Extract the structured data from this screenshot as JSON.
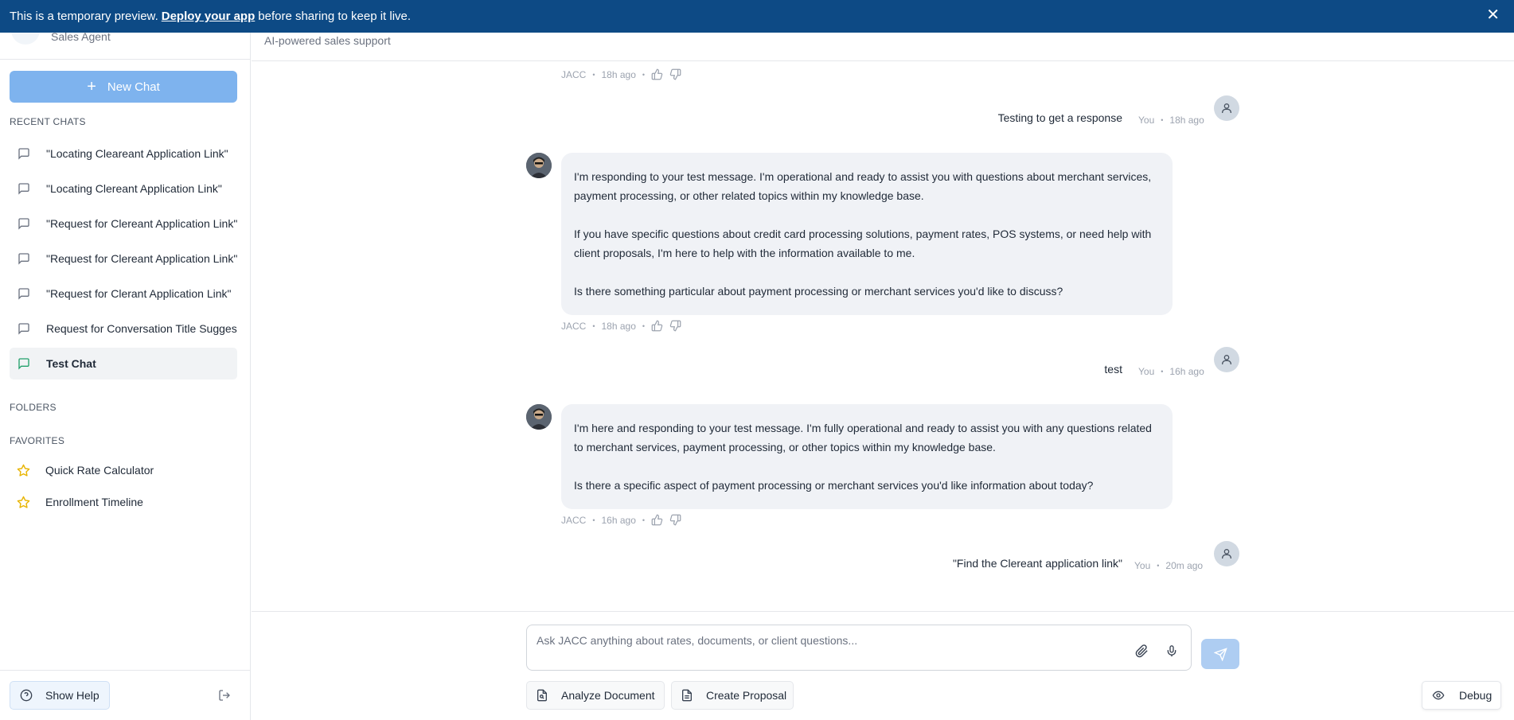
{
  "banner": {
    "prefix": "This is a temporary preview.",
    "link": "Deploy your app",
    "suffix": "before sharing to keep it live."
  },
  "sidebar": {
    "agent_role": "Sales Agent",
    "new_chat_label": "New Chat",
    "recent_title": "RECENT CHATS",
    "recent_chats": [
      "\"Locating Cleareant Application Link\"",
      "\"Locating Clereant Application Link\"",
      "\"Request for Clereant Application Link\"",
      "\"Request for Clereant Application Link\"",
      "\"Request for Clerant Application Link\"",
      "Request for Conversation Title Suggestion",
      "Test Chat"
    ],
    "folders_title": "FOLDERS",
    "favorites_title": "FAVORITES",
    "favorites": [
      "Quick Rate Calculator",
      "Enrollment Timeline"
    ],
    "show_help": "Show Help"
  },
  "header": {
    "subtitle": "AI-powered sales support"
  },
  "messages": {
    "m0": {
      "sender": "JACC",
      "time": "18h ago"
    },
    "m1": {
      "text": "Testing to get a response",
      "sender": "You",
      "time": "18h ago"
    },
    "m2": {
      "sender": "JACC",
      "time": "18h ago",
      "p1": "I'm responding to your test message. I'm operational and ready to assist you with questions about merchant services, payment processing, or other related topics within my knowledge base.",
      "p2": "If you have specific questions about credit card processing solutions, payment rates, POS systems, or need help with client proposals, I'm here to help with the information available to me.",
      "p3": "Is there something particular about payment processing or merchant services you'd like to discuss?"
    },
    "m3": {
      "text": "test",
      "sender": "You",
      "time": "16h ago"
    },
    "m4": {
      "sender": "JACC",
      "time": "16h ago",
      "p1": "I'm here and responding to your test message. I'm fully operational and ready to assist you with any questions related to merchant services, payment processing, or other topics within my knowledge base.",
      "p2": "Is there a specific aspect of payment processing or merchant services you'd like information about today?"
    },
    "m5": {
      "text": "\"Find the Clereant application link\"",
      "sender": "You",
      "time": "20m ago"
    },
    "separator": "•"
  },
  "composer": {
    "placeholder": "Ask JACC anything about rates, documents, or client questions...",
    "analyze_label": "Analyze Document",
    "proposal_label": "Create Proposal",
    "debug_label": "Debug"
  },
  "colors": {
    "banner": "#0d4a85",
    "new_chat": "#7eb3ee",
    "active_chat_icon": "#22a06b",
    "favorite_star": "#e8b400",
    "bubble": "#f0f2f6"
  },
  "icons": {
    "close": "close-icon",
    "plus": "plus-icon",
    "chat": "message-square-icon",
    "star": "star-icon",
    "help": "help-circle-icon",
    "logout": "logout-icon",
    "user": "user-icon",
    "thumbs_up": "thumbs-up-icon",
    "thumbs_down": "thumbs-down-icon",
    "paperclip": "paperclip-icon",
    "mic": "mic-icon",
    "send": "send-icon",
    "document": "document-icon",
    "eye": "eye-icon"
  }
}
